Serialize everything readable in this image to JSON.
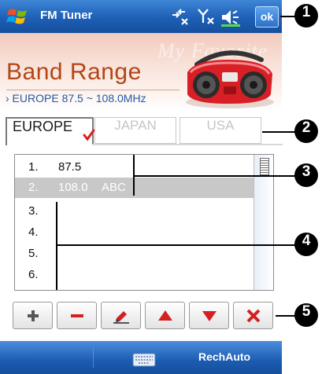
{
  "titlebar": {
    "title": "FM Tuner",
    "ok_label": "ok",
    "icons": [
      "windows-start-icon",
      "connectivity-icon",
      "signal-icon",
      "volume-icon"
    ]
  },
  "callouts": [
    "1",
    "2",
    "3",
    "4",
    "5"
  ],
  "banner": {
    "watermark": "My Favorite",
    "title": "Band Range",
    "range": "› EUROPE 87.5 ~ 108.0MHz"
  },
  "tabs": [
    {
      "label": "EUROPE",
      "active": true
    },
    {
      "label": "JAPAN",
      "active": false
    },
    {
      "label": "USA",
      "active": false
    }
  ],
  "stations": [
    {
      "number": "1.",
      "freq": "87.5",
      "name": "",
      "selected": false
    },
    {
      "number": "2.",
      "freq": "108.0",
      "name": "ABC",
      "selected": true
    },
    {
      "number": "3.",
      "freq": "",
      "name": "",
      "selected": false
    },
    {
      "number": "4.",
      "freq": "",
      "name": "",
      "selected": false
    },
    {
      "number": "5.",
      "freq": "",
      "name": "",
      "selected": false
    },
    {
      "number": "6.",
      "freq": "",
      "name": "",
      "selected": false
    }
  ],
  "toolbar": {
    "buttons": [
      "add-icon",
      "remove-icon",
      "edit-icon",
      "move-up-icon",
      "move-down-icon",
      "delete-icon"
    ]
  },
  "menubar": {
    "right_label": "RechAuto",
    "center_icon": "keyboard-icon"
  },
  "colors": {
    "titlebar": "#1d5fb6",
    "band_title": "#b24617",
    "band_range": "#2459a3",
    "toolbar_red": "#d42020",
    "selected_row": "#c8c8c8"
  }
}
